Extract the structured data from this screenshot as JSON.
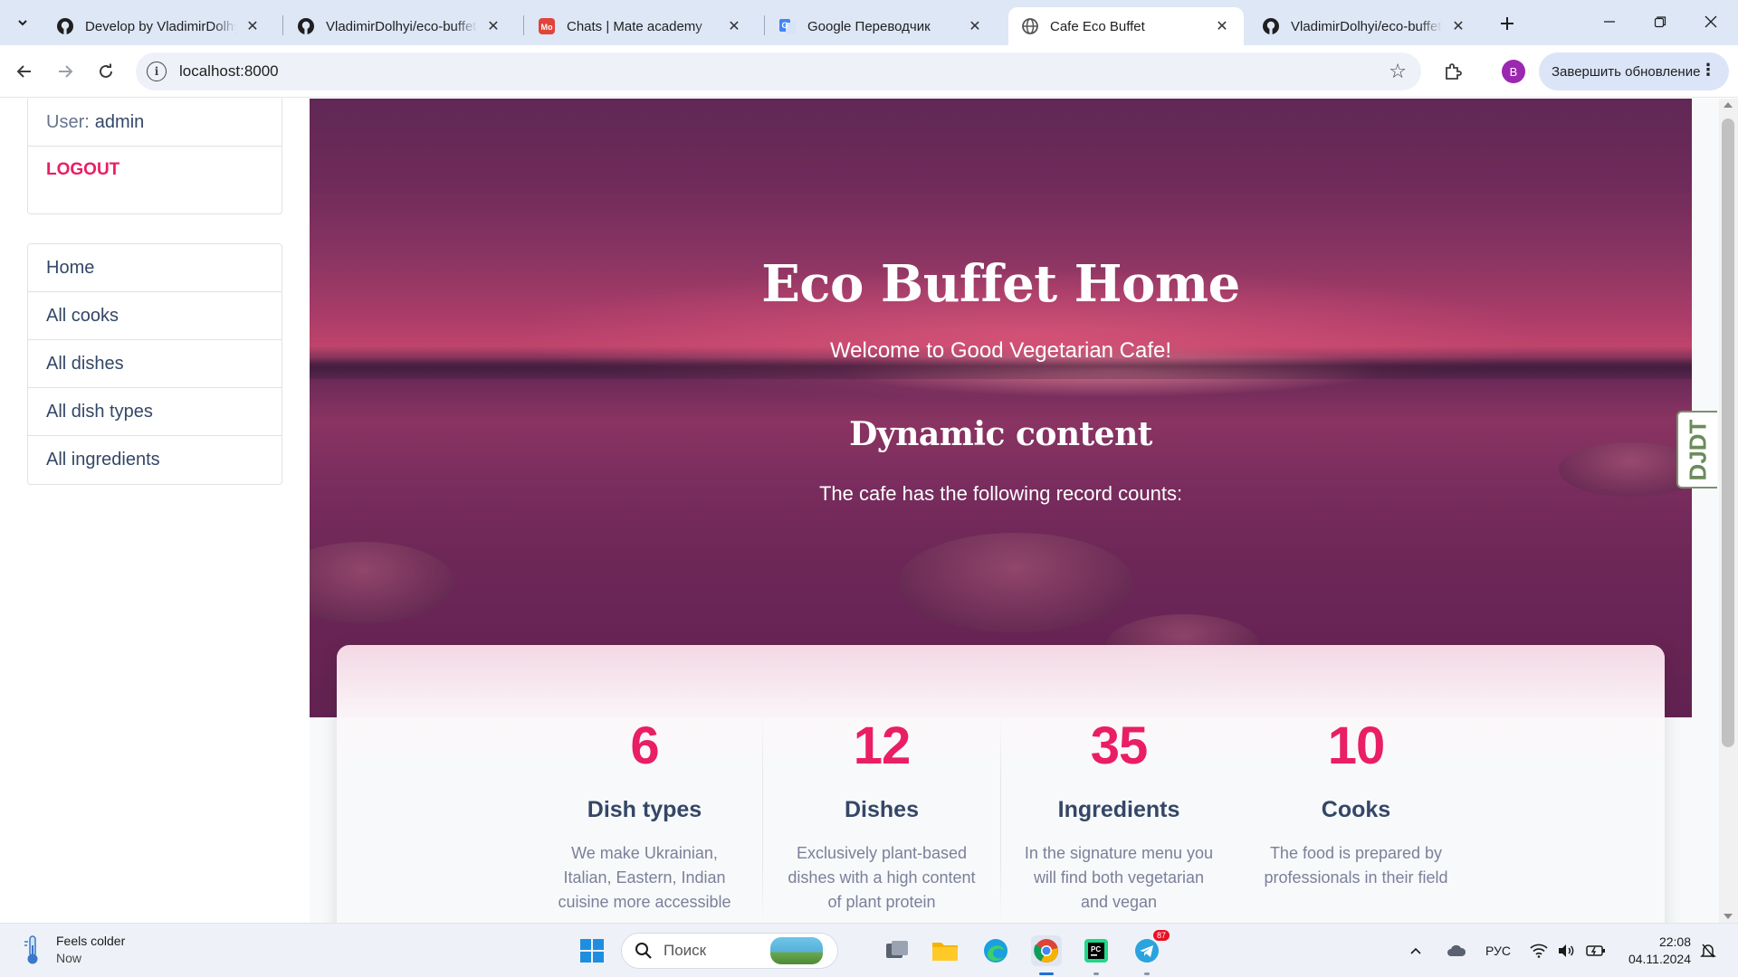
{
  "browser": {
    "tabs": [
      {
        "title": "Develop by VladimirDolhyi",
        "favicon": "github-icon",
        "active": false
      },
      {
        "title": "VladimirDolhyi/eco-buffet",
        "favicon": "github-icon",
        "active": false
      },
      {
        "title": "Chats | Mate academy",
        "favicon": "mate-academy-icon",
        "active": false
      },
      {
        "title": "Google Переводчик",
        "favicon": "google-translate-icon",
        "active": false
      },
      {
        "title": "Cafe Eco Buffet",
        "favicon": "globe-icon",
        "active": true
      },
      {
        "title": "VladimirDolhyi/eco-buffet",
        "favicon": "github-icon",
        "active": false
      }
    ],
    "url": "localhost:8000",
    "profile_initial": "B",
    "update_label": "Завершить обновление"
  },
  "sidebar": {
    "user_label": "User:",
    "username": "admin",
    "logout_label": "LOGOUT",
    "nav": [
      {
        "label": "Home"
      },
      {
        "label": "All cooks"
      },
      {
        "label": "All dishes"
      },
      {
        "label": "All dish types"
      },
      {
        "label": "All ingredients"
      }
    ]
  },
  "hero": {
    "title": "Eco Buffet Home",
    "subtitle": "Welcome to Good Vegetarian Cafe!",
    "heading": "Dynamic content",
    "text": "The cafe has the following record counts:"
  },
  "stats": [
    {
      "count": "6",
      "title": "Dish types",
      "desc": "We make Ukrainian, Italian, Eastern, Indian cuisine more accessible"
    },
    {
      "count": "12",
      "title": "Dishes",
      "desc": "Exclusively plant-based dishes with a high content of plant protein"
    },
    {
      "count": "35",
      "title": "Ingredients",
      "desc": "In the signature menu you will find both vegetarian and vegan"
    },
    {
      "count": "10",
      "title": "Cooks",
      "desc": "The food is prepared by professionals in their field"
    }
  ],
  "debug_toolbar_label": "DJDT",
  "taskbar": {
    "weather_title": "Feels colder",
    "weather_sub": "Now",
    "search_placeholder": "Поиск",
    "telegram_badge": "87",
    "language": "РУС",
    "time": "22:08",
    "date": "04.11.2024"
  },
  "colors": {
    "accent": "#e91e63",
    "text_dark": "#344767",
    "text_muted": "#7b809a"
  }
}
